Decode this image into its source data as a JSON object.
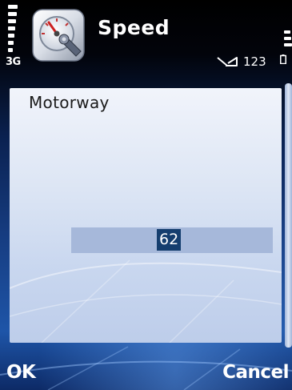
{
  "status_pane": {
    "network_type": "3G",
    "indicator_text": "123",
    "icons": [
      "signal-strength-icon",
      "app-speed-gauge-icon",
      "message-indicator-icon",
      "battery-level-icon"
    ]
  },
  "title_pane": {
    "title": "Speed"
  },
  "setting_dialog": {
    "label": "Motorway",
    "value": "62"
  },
  "softkeys": {
    "left": "OK",
    "right": "Cancel"
  },
  "colors": {
    "background": "#163c80",
    "dialog": "#dce5f4",
    "value_field": "#a6b8da",
    "value_highlight": "#153e6e"
  }
}
